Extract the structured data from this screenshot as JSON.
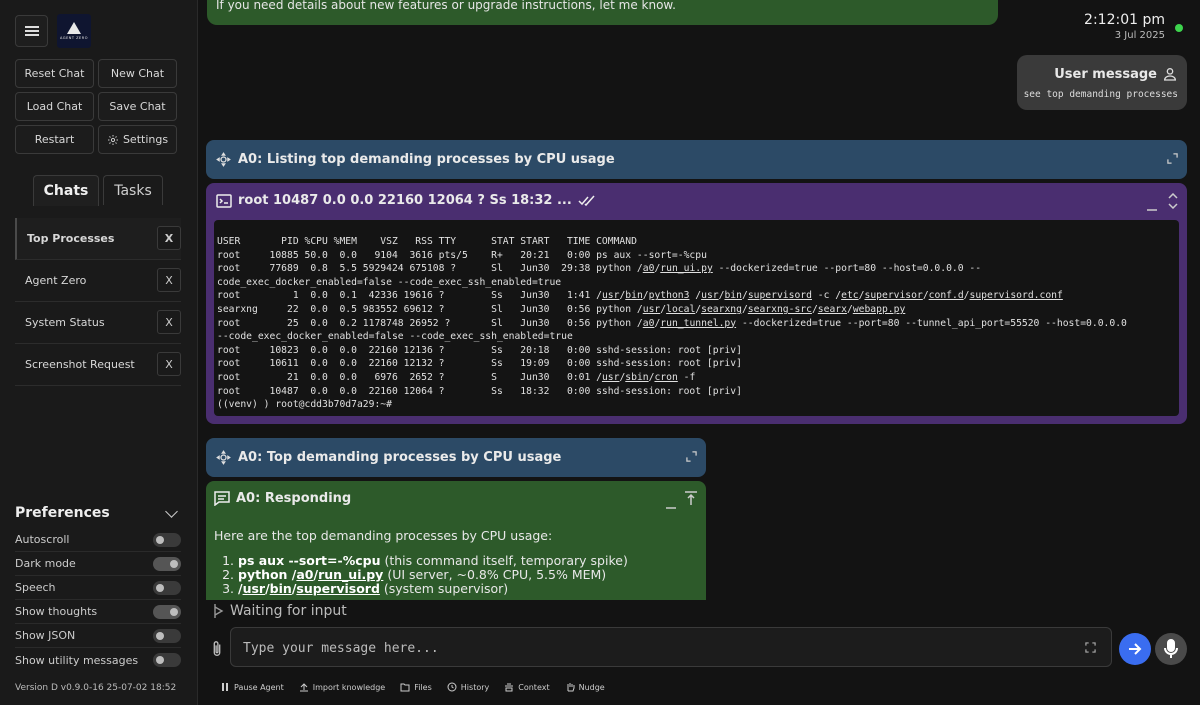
{
  "sidebar": {
    "logo_text": "AGENT ZERO",
    "buttons": {
      "reset_chat": "Reset Chat",
      "new_chat": "New Chat",
      "load_chat": "Load Chat",
      "save_chat": "Save Chat",
      "restart": "Restart",
      "settings": "Settings"
    },
    "tabs": {
      "chats": "Chats",
      "tasks": "Tasks"
    },
    "chats": [
      {
        "label": "Top Processes"
      },
      {
        "label": "Agent Zero"
      },
      {
        "label": "System Status"
      },
      {
        "label": "Screenshot Request"
      }
    ],
    "close_label": "X",
    "preferences": {
      "title": "Preferences",
      "items": [
        {
          "label": "Autoscroll",
          "on": false
        },
        {
          "label": "Dark mode",
          "on": true
        },
        {
          "label": "Speech",
          "on": false
        },
        {
          "label": "Show thoughts",
          "on": true
        },
        {
          "label": "Show JSON",
          "on": false
        },
        {
          "label": "Show utility messages",
          "on": false
        }
      ]
    },
    "version": "Version D v0.9.0-16 25-07-02 18:52"
  },
  "main": {
    "top_message": "If you need details about new features or upgrade instructions, let me know.",
    "time": "2:12:01 pm",
    "date": "3 Jul 2025",
    "user_message": {
      "title": "User message",
      "text": "see top demanding processes"
    },
    "header1": "A0: Listing top demanding processes by CPU usage",
    "code_title": "root 10487 0.0 0.0 22160 12064 ? Ss 18:32 ...",
    "header2": "A0: Top demanding processes by CPU usage",
    "response": {
      "title": "A0: Responding",
      "intro": "Here are the top demanding processes by CPU usage:",
      "items": [
        {
          "cmd": "ps aux --sort=-%cpu",
          "desc": " (this command itself, temporary spike)"
        },
        {
          "cmd_parts": [
            "python /",
            "a0",
            "/",
            "run_ui.py"
          ],
          "desc": " (UI server, ~0.8% CPU, 5.5% MEM)"
        },
        {
          "cmd_parts": [
            "/",
            "usr",
            "/",
            "bin",
            "/",
            "supervisord"
          ],
          "desc": " (system supervisor)"
        }
      ]
    }
  },
  "input": {
    "waiting": "Waiting for input",
    "placeholder": "Type your message here..."
  },
  "toolbar": {
    "pause": "Pause Agent",
    "import": "Import knowledge",
    "files": "Files",
    "history": "History",
    "context": "Context",
    "nudge": "Nudge"
  },
  "colors": {
    "accent": "#3a6df0",
    "status_online": "#3dd44d",
    "response_bg": "#2d5a2a",
    "header_bg": "#2c4a66",
    "code_bg": "#4a2e70"
  }
}
